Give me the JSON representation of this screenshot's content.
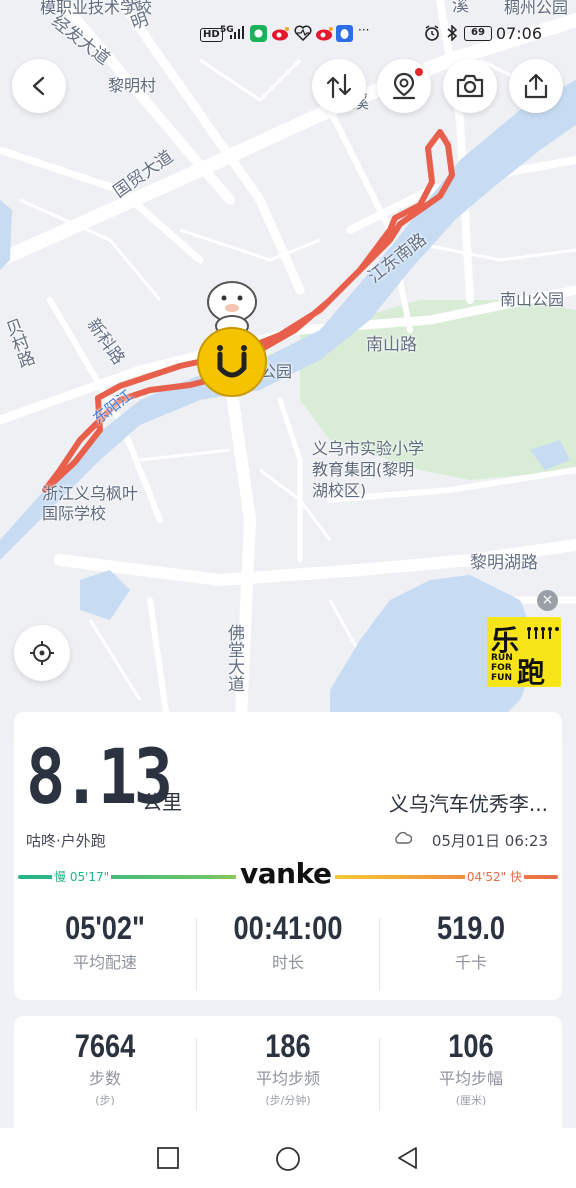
{
  "status_bar": {
    "left_icons": [
      "hd-icon",
      "signal-icon",
      "app-icon",
      "weibo-icon",
      "heart-rate-icon",
      "weibo-icon",
      "qq-icon",
      "more-icon"
    ],
    "hd": "HD",
    "net": "5G",
    "more": "···",
    "battery": "69",
    "time": "07:06"
  },
  "map": {
    "labels": {
      "top_left_school": "模职业技术学校",
      "jingfa_road": "经发大道",
      "liming_village": "黎明村",
      "qingxi": "清溪",
      "guomao_road": "国贸大道",
      "jiangdong_south": "江东南路",
      "nanshan_park": "南山公园",
      "nanshan_road": "南山路",
      "xinke_road": "新科路",
      "beicun_road": "贝村路",
      "dongyang_river": "东阳江",
      "park": "公园",
      "experimental_school": "义乌市实验小学教育集团(黎明湖校区)",
      "fengye_school": "浙江义乌枫叶国际学校",
      "liminghu_road": "黎明湖路",
      "fotang_road": "佛堂大道",
      "fotang_road_top": "佛堂",
      "top_right_area": "稠州公园",
      "xi": "溪",
      "guangming": "光明"
    }
  },
  "ad": {
    "char1": "乐",
    "char2": "跑",
    "run_text": "RUN\nFOR\nFUN",
    "close": "×"
  },
  "summary": {
    "distance": "8.13",
    "distance_unit": "公里",
    "route_name": "义乌汽车优秀李...",
    "sport_type": "咕咚·户外跑",
    "start_time": "05月01日 06:23",
    "slow_pace": "慢 05'17\"",
    "fast_pace": "04'52\" 快",
    "sponsor": "vanke",
    "stats": [
      {
        "value": "05'02\"",
        "label": "平均配速"
      },
      {
        "value": "00:41:00",
        "label": "时长"
      },
      {
        "value": "519.0",
        "label": "千卡"
      }
    ],
    "stats2": [
      {
        "value": "7664",
        "label": "步数",
        "unit": "(步)"
      },
      {
        "value": "186",
        "label": "平均步频",
        "unit": "(步/分钟)"
      },
      {
        "value": "106",
        "label": "平均步幅",
        "unit": "(厘米)"
      }
    ]
  },
  "colors": {
    "route": "#e8604c",
    "river": "#c7dcf3",
    "park_green": "#d8ecd6",
    "pace_slow": "#21b487",
    "pace_fast": "#e86b47"
  }
}
